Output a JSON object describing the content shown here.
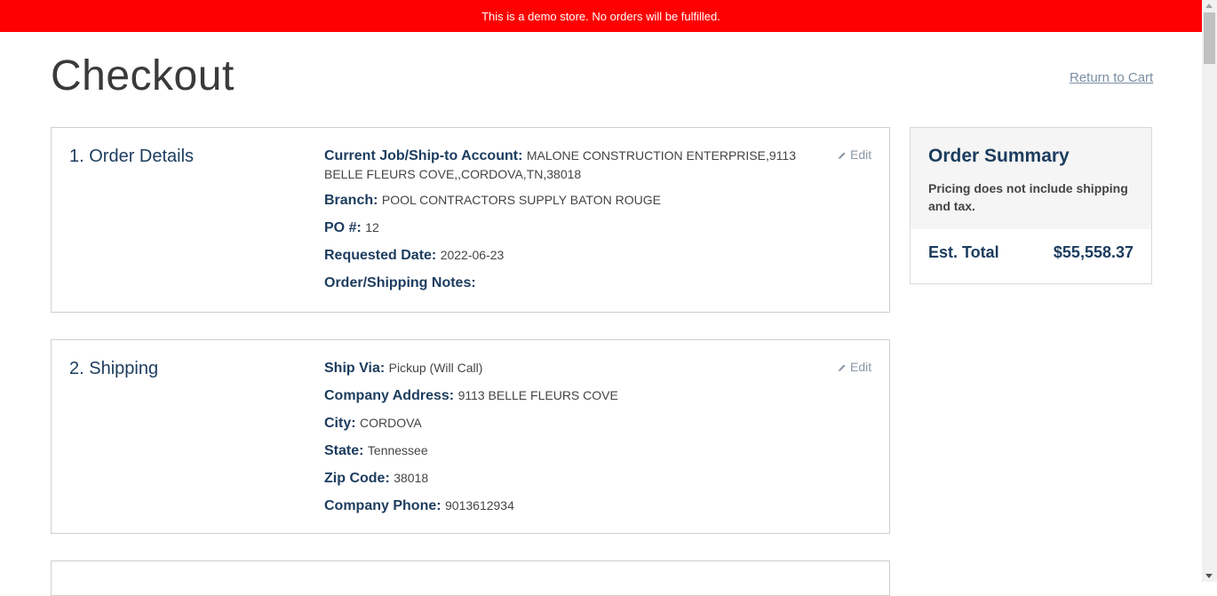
{
  "banner": {
    "text": "This is a demo store. No orders will be fulfilled."
  },
  "page": {
    "title": "Checkout",
    "return_link": "Return to Cart"
  },
  "order_details": {
    "heading": "1. Order Details",
    "edit_label": "Edit",
    "fields": [
      {
        "label": "Current Job/Ship-to Account:",
        "value": "MALONE CONSTRUCTION ENTERPRISE,9113 BELLE FLEURS COVE,,CORDOVA,TN,38018"
      },
      {
        "label": "Branch:",
        "value": "POOL CONTRACTORS SUPPLY BATON ROUGE"
      },
      {
        "label": "PO #:",
        "value": "12"
      },
      {
        "label": "Requested Date:",
        "value": "2022-06-23"
      },
      {
        "label": "Order/Shipping Notes:",
        "value": ""
      }
    ]
  },
  "shipping": {
    "heading": "2. Shipping",
    "edit_label": "Edit",
    "fields": [
      {
        "label": "Ship Via:",
        "value": "Pickup (Will Call)"
      },
      {
        "label": "Company Address:",
        "value": "9113 BELLE FLEURS COVE"
      },
      {
        "label": "City:",
        "value": "CORDOVA"
      },
      {
        "label": "State:",
        "value": "Tennessee"
      },
      {
        "label": "Zip Code:",
        "value": "38018"
      },
      {
        "label": "Company Phone:",
        "value": "9013612934"
      }
    ]
  },
  "summary": {
    "title": "Order Summary",
    "note": "Pricing does not include shipping and tax.",
    "total_label": "Est. Total",
    "total_value": "$55,558.37"
  },
  "icons": {
    "edit": "pencil-icon"
  },
  "colors": {
    "banner": "#ff0000",
    "heading": "#1c3c5e"
  }
}
